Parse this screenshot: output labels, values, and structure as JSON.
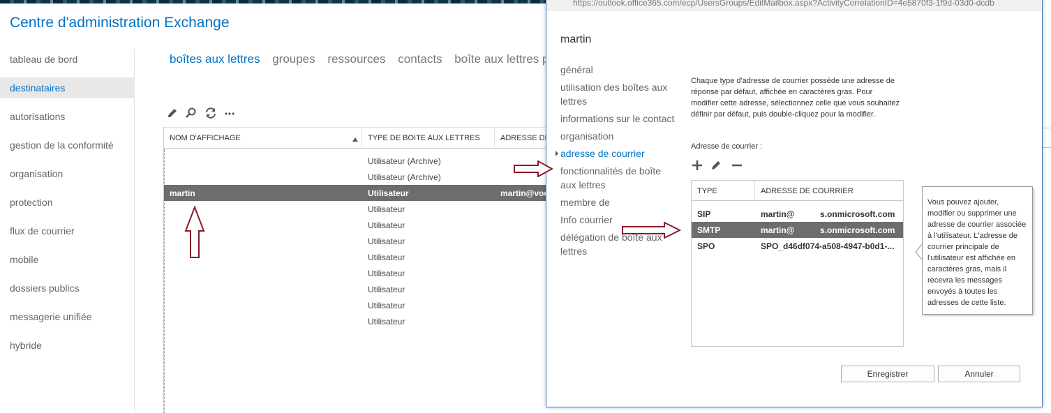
{
  "app": {
    "title": "Centre d'administration Exchange"
  },
  "leftnav": {
    "items": [
      {
        "label": "tableau de bord"
      },
      {
        "label": "destinataires",
        "active": true
      },
      {
        "label": "autorisations"
      },
      {
        "label": "gestion de la conformité"
      },
      {
        "label": "organisation"
      },
      {
        "label": "protection"
      },
      {
        "label": "flux de courrier"
      },
      {
        "label": "mobile"
      },
      {
        "label": "dossiers publics"
      },
      {
        "label": "messagerie unifiée"
      },
      {
        "label": "hybride"
      }
    ]
  },
  "subtabs": [
    {
      "label": "boîtes aux lettres",
      "active": true
    },
    {
      "label": "groupes"
    },
    {
      "label": "ressources"
    },
    {
      "label": "contacts"
    },
    {
      "label": "boîte aux lettres pa"
    }
  ],
  "toolbar": {
    "icons": [
      "edit-icon",
      "search-icon",
      "refresh-icon",
      "more-icon"
    ]
  },
  "grid": {
    "columns": [
      "NOM D'AFFICHAGE",
      "TYPE DE BOITE AUX LETTRES",
      "ADRESSE DE C"
    ],
    "rows": [
      {
        "name": "",
        "type": "Utilisateur (Archive)",
        "address": ""
      },
      {
        "name": "",
        "type": "Utilisateur (Archive)",
        "address": ""
      },
      {
        "name": "martin",
        "type": "Utilisateur",
        "address": "martin@voc",
        "selected": true
      },
      {
        "name": "",
        "type": "Utilisateur",
        "address": ""
      },
      {
        "name": "",
        "type": "Utilisateur",
        "address": ""
      },
      {
        "name": "",
        "type": "Utilisateur",
        "address": ""
      },
      {
        "name": "",
        "type": "Utilisateur",
        "address": ""
      },
      {
        "name": "",
        "type": "Utilisateur",
        "address": ""
      },
      {
        "name": "",
        "type": "Utilisateur",
        "address": ""
      },
      {
        "name": "",
        "type": "Utilisateur",
        "address": ""
      },
      {
        "name": "",
        "type": "Utilisateur",
        "address": ""
      }
    ]
  },
  "dialog": {
    "url": "https://outlook.office365.com/ecp/UsersGroups/EditMailbox.aspx?ActivityCorrelationID=4e5870f3-1f9d-03d0-dcdb",
    "title": "martin",
    "nav": [
      {
        "label": "général"
      },
      {
        "label": "utilisation des boîtes aux lettres"
      },
      {
        "label": "informations sur le contact"
      },
      {
        "label": "organisation"
      },
      {
        "label": "adresse de courrier",
        "active": true
      },
      {
        "label": "fonctionnalités de boîte aux lettres"
      },
      {
        "label": "membre de"
      },
      {
        "label": "Info courrier"
      },
      {
        "label": "délégation de boîte aux lettres"
      }
    ],
    "description": "Chaque type d'adresse de courrier possède une adresse de réponse par défaut, affichée en caractères gras. Pour modifier cette adresse, sélectionnez celle que vous souhaitez définir par défaut, puis double-cliquez pour la modifier.",
    "address_label": "Adresse de courrier :",
    "address_columns": [
      "TYPE",
      "ADRESSE DE COURRIER"
    ],
    "addresses": [
      {
        "type": "SIP",
        "address": "martin@           s.onmicrosoft.com"
      },
      {
        "type": "SMTP",
        "address": "martin@           s.onmicrosoft.com",
        "selected": true
      },
      {
        "type": "SPO",
        "address": "SPO_d46df074-a508-4947-b0d1-..."
      }
    ],
    "callout": "Vous pouvez ajouter, modifier ou supprimer une adresse de courrier associée à l'utilisateur. L'adresse de courrier principale de l'utilisateur est affichée en caractères gras, mais il recevra les messages envoyés à toutes les adresses de cette liste.",
    "save_label": "Enregistrer",
    "cancel_label": "Annuler"
  },
  "colors": {
    "accent": "#0072c6",
    "selected_row": "#6d6d6d",
    "annotation_arrow": "#8b1a2b"
  }
}
